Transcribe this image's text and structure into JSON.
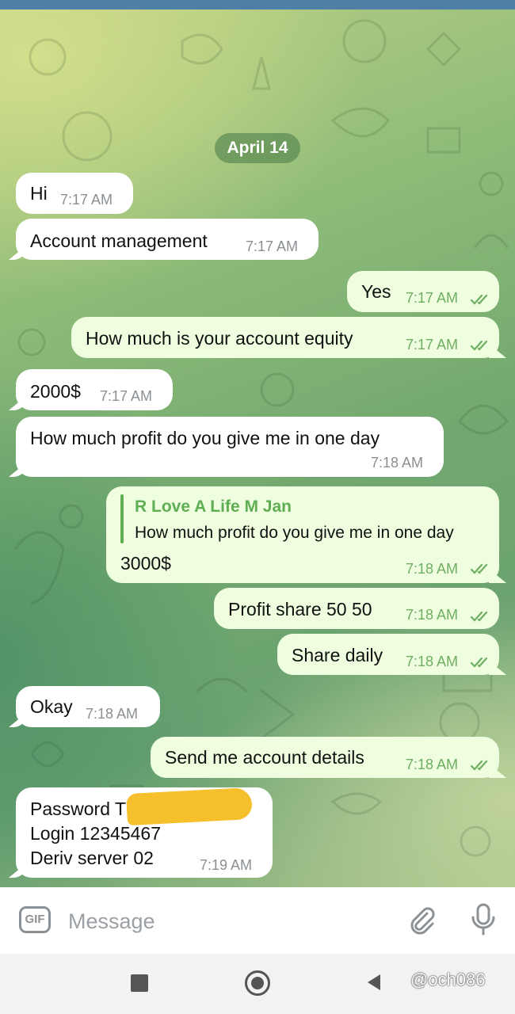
{
  "chat": {
    "date": "April 14",
    "messages": [
      {
        "text": "Hi",
        "time": "7:17 AM"
      },
      {
        "text": "Account management",
        "time": "7:17 AM"
      },
      {
        "text": "Yes",
        "time": "7:17 AM"
      },
      {
        "text": "How much is your account equity",
        "time": "7:17 AM"
      },
      {
        "text": "2000$",
        "time": "7:17 AM"
      },
      {
        "text": "How much profit do you give me in one day",
        "time": "7:18 AM"
      },
      {
        "reply_name": "R Love A Life M Jan",
        "reply_text": "How much profit do you give me in one day",
        "text": "3000$",
        "time": "7:18 AM"
      },
      {
        "text": "Profit share 50 50",
        "time": "7:18 AM"
      },
      {
        "text": "Share daily",
        "time": "7:18 AM"
      },
      {
        "text": "Okay",
        "time": "7:18 AM"
      },
      {
        "text": "Send me account details",
        "time": "7:18 AM"
      },
      {
        "lines": [
          "Password T",
          "Login 12345467",
          "Deriv server 02"
        ],
        "time": "7:19 AM"
      }
    ]
  },
  "input": {
    "gif_label": "GIF",
    "placeholder": "Message"
  },
  "icons": {
    "attach": "paperclip-icon",
    "mic": "microphone-icon",
    "read_receipt": "double-check-icon"
  },
  "watermark": "@och086",
  "colors": {
    "incoming": "#ffffff",
    "outgoing": "#eefedf",
    "accent": "#5fae53",
    "header": "#4f7fa7"
  }
}
